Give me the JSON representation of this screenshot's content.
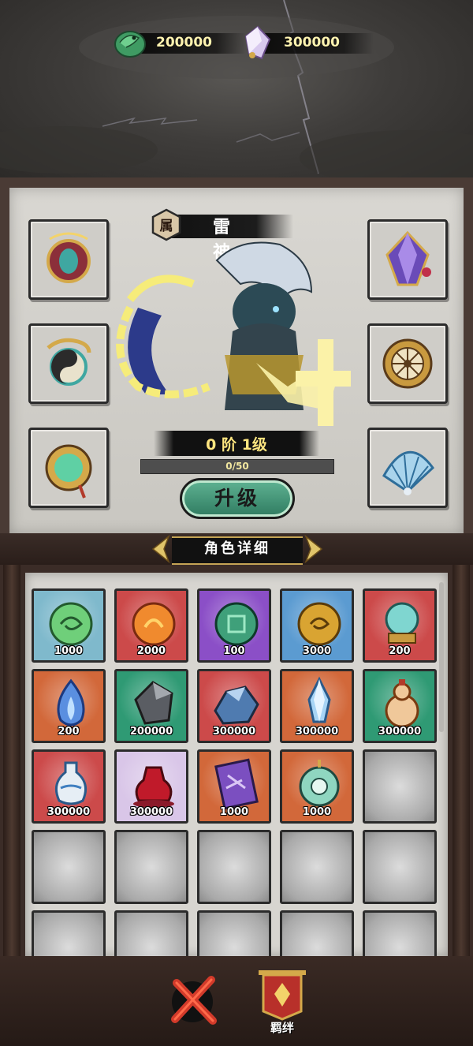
{
  "currencies": [
    {
      "icon": "jade-dragon-icon",
      "value": "200000"
    },
    {
      "icon": "crystal-icon",
      "value": "300000"
    }
  ],
  "hero": {
    "attribute_badge": "属",
    "name": "雷神",
    "level": "0 阶 1级",
    "exp_text": "0/50",
    "exp_progress": 0
  },
  "equipment_left": [
    "ornate-amulet-icon",
    "dragon-yinyang-icon",
    "jade-mirror-icon"
  ],
  "equipment_right": [
    "crystal-gem-icon",
    "golden-wheel-icon",
    "feather-fan-icon"
  ],
  "upgrade_button": "升级",
  "detail_tab": "角色详细",
  "inventory": [
    {
      "icon": "green-orb-icon",
      "bg": "#7fb9cc",
      "count": "1000"
    },
    {
      "icon": "fire-orb-icon",
      "bg": "#cc4a4a",
      "count": "2000"
    },
    {
      "icon": "jade-seal-orb-icon",
      "bg": "#8b4fc7",
      "count": "100"
    },
    {
      "icon": "golden-orb-icon",
      "bg": "#5b9bd1",
      "count": "3000"
    },
    {
      "icon": "crystal-ball-icon",
      "bg": "#cc4a4a",
      "count": "200"
    },
    {
      "icon": "blue-flame-icon",
      "bg": "#d2683a",
      "count": "200"
    },
    {
      "icon": "dark-stone-icon",
      "bg": "#2f9a74",
      "count": "200000"
    },
    {
      "icon": "blue-ore-icon",
      "bg": "#cc4a4a",
      "count": "300000"
    },
    {
      "icon": "ice-crystal-icon",
      "bg": "#d2683a",
      "count": "300000"
    },
    {
      "icon": "gourd-bottle-icon",
      "bg": "#2f9a74",
      "count": "300000"
    },
    {
      "icon": "vase-icon",
      "bg": "#cc4a4a",
      "count": "300000"
    },
    {
      "icon": "red-potion-icon",
      "bg": "#d9c6e8",
      "count": "300000"
    },
    {
      "icon": "purple-scroll-icon",
      "bg": "#d2683a",
      "count": "1000"
    },
    {
      "icon": "jade-pendant-icon",
      "bg": "#d2683a",
      "count": "1000"
    }
  ],
  "empty_slots": 11,
  "bond_label": "羁绊"
}
